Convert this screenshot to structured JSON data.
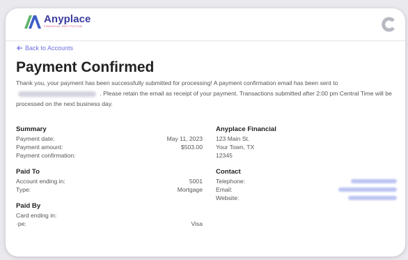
{
  "logo": {
    "brand": "Anyplace",
    "tagline": "FINANCIAL INSTITUTION"
  },
  "nav": {
    "back_label": "Back to Accounts"
  },
  "page_title": "Payment Confirmed",
  "message": {
    "part1": "Thank you, your payment has been successfully submitted for processing! A payment confirmation email has been sent to",
    "part2": ". Please retain the email as receipt of your payment. Transactions submitted after 2:00 pm Central Time will be processed on the next business day."
  },
  "summary": {
    "title": "Summary",
    "rows": [
      {
        "label": "Payment date:",
        "value": "May 11, 2023"
      },
      {
        "label": "Payment amount:",
        "value": "$503.00"
      },
      {
        "label": "Payment confirmation:",
        "value": ""
      }
    ]
  },
  "paid_to": {
    "title": "Paid To",
    "rows": [
      {
        "label": "Account ending in:",
        "value": "5001"
      },
      {
        "label": "Type:",
        "value": "Mortgage"
      }
    ]
  },
  "paid_by": {
    "title": "Paid By",
    "rows": [
      {
        "label": "Card ending in:",
        "value": ""
      },
      {
        "label": "·pe:",
        "value": "Visa"
      }
    ]
  },
  "institution": {
    "name": "Anyplace Financial",
    "address": [
      "123 Main St.",
      "Your Town, TX",
      "12345"
    ]
  },
  "contact": {
    "title": "Contact",
    "rows": [
      {
        "label": "Telephone:"
      },
      {
        "label": "Email:"
      },
      {
        "label": "Website:"
      }
    ]
  },
  "colors": {
    "brand": "#3a3a9e",
    "logo_green": "#5fb46c",
    "logo_blue": "#3d5fc8",
    "link": "#6e6ee0"
  },
  "icons": {
    "back": "arrow-left-icon",
    "corner": "c-shape-icon"
  }
}
